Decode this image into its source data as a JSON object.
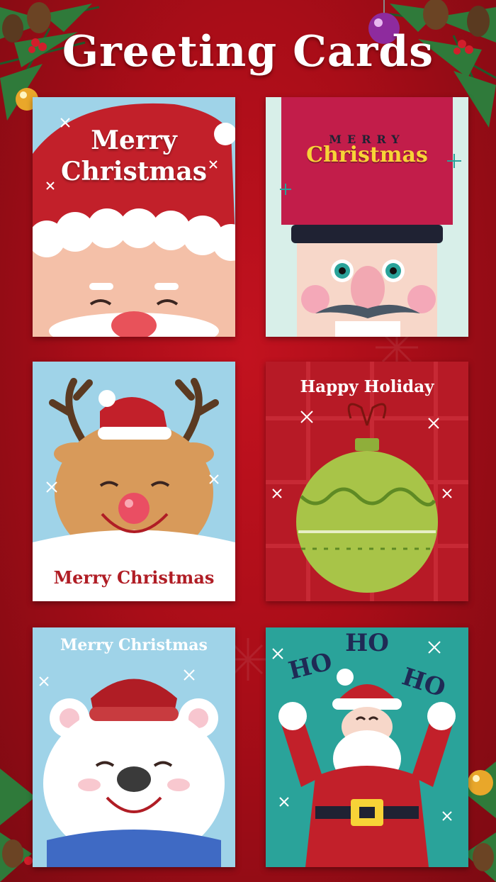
{
  "title": "Greeting Cards",
  "colors": {
    "background": "#a90d18",
    "title_text": "#ffffff"
  },
  "cards": [
    {
      "name": "santa-merry-christmas",
      "line1": "Merry",
      "line2": "Christmas"
    },
    {
      "name": "nutcracker-merry-christmas",
      "line1": "MERRY",
      "line2": "Christmas"
    },
    {
      "name": "reindeer-merry-christmas",
      "line1": "Merry Christmas"
    },
    {
      "name": "ornament-happy-holiday",
      "line1": "Happy Holiday"
    },
    {
      "name": "polar-bear-merry-christmas",
      "line1": "Merry Christmas"
    },
    {
      "name": "santa-ho-ho-ho",
      "word1": "HO",
      "word2": "HO",
      "word3": "HO"
    }
  ]
}
